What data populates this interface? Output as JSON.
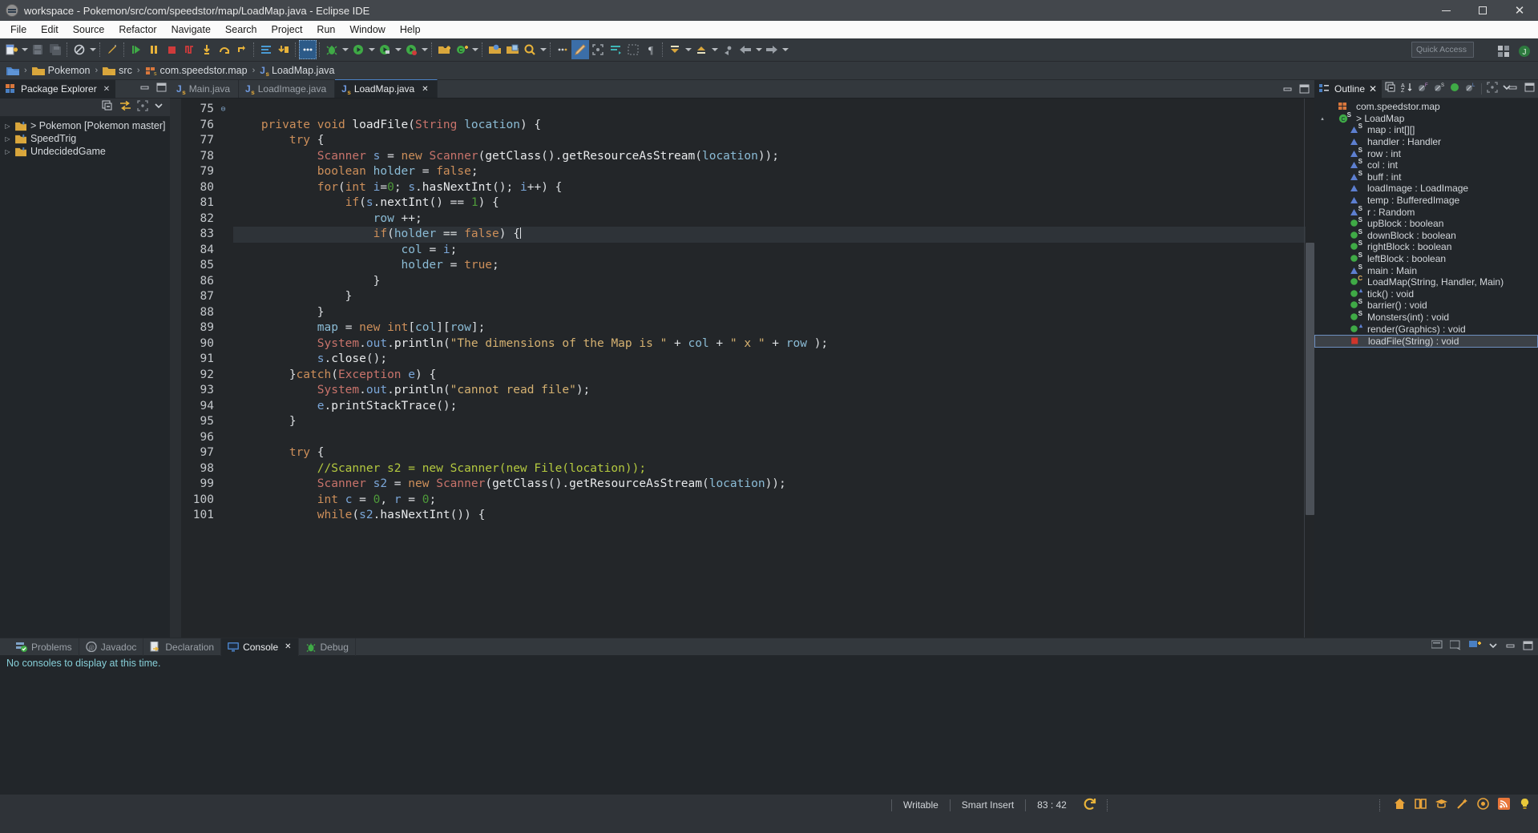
{
  "window": {
    "title": "workspace - Pokemon/src/com/speedstor/map/LoadMap.java - Eclipse IDE",
    "app_icon": "eclipse-icon",
    "minimize_label": "Minimize",
    "maximize_label": "Maximize",
    "close_label": "✕"
  },
  "menu": {
    "items": [
      "File",
      "Edit",
      "Source",
      "Refactor",
      "Navigate",
      "Search",
      "Project",
      "Run",
      "Window",
      "Help"
    ]
  },
  "toolbar": {
    "quick_access_placeholder": "Quick Access",
    "groups": [
      {
        "name": "file",
        "buttons": [
          {
            "icon": "new-wizard-icon",
            "label": "New",
            "dropdown": true,
            "color": "#e8b33a"
          },
          {
            "icon": "save-icon",
            "label": "Save",
            "dropdown": false,
            "color": "#5d646c"
          },
          {
            "icon": "save-all-icon",
            "label": "Save All",
            "dropdown": false,
            "color": "#5d646c"
          }
        ]
      },
      {
        "name": "skip-breakpoints",
        "buttons": [
          {
            "icon": "breakpoint-skip-icon",
            "label": "Skip All Breakpoints",
            "dropdown": true,
            "color": "#c9ced4"
          }
        ]
      },
      {
        "name": "debug-controls",
        "buttons": [
          {
            "icon": "resume-icon",
            "label": "Resume",
            "dropdown": false,
            "color": "#3faa46"
          },
          {
            "icon": "suspend-icon",
            "label": "Suspend",
            "dropdown": false,
            "color": "#e8b33a"
          },
          {
            "icon": "terminate-icon",
            "label": "Terminate",
            "dropdown": false,
            "color": "#cf3b3b"
          },
          {
            "icon": "disconnect-icon",
            "label": "Disconnect",
            "dropdown": false,
            "color": "#cf3b3b"
          },
          {
            "icon": "step-into-icon",
            "label": "Step Into",
            "dropdown": false,
            "color": "#e8b33a"
          },
          {
            "icon": "step-over-icon",
            "label": "Step Over",
            "dropdown": false,
            "color": "#e8b33a"
          },
          {
            "icon": "step-return-icon",
            "label": "Step Return",
            "dropdown": false,
            "color": "#e8b33a"
          }
        ]
      },
      {
        "name": "console",
        "buttons": [
          {
            "icon": "console-toggle-icon",
            "label": "Display Selected Console",
            "dropdown": false,
            "color": "#4a9bd4"
          },
          {
            "icon": "drop-to-frame-icon",
            "label": "Drop To Frame",
            "dropdown": false,
            "color": "#e8b33a"
          }
        ]
      },
      {
        "name": "inspect",
        "buttons": [
          {
            "icon": "more-icon",
            "label": "More",
            "dropdown": false,
            "color": "#c9ced4"
          }
        ]
      },
      {
        "name": "run-debug",
        "buttons": [
          {
            "icon": "debug-icon",
            "label": "Debug",
            "dropdown": true,
            "color": "#3faa46"
          },
          {
            "icon": "run-icon",
            "label": "Run",
            "dropdown": true,
            "color": "#3faa46"
          },
          {
            "icon": "coverage-icon",
            "label": "Coverage",
            "dropdown": true,
            "color": "#3faa46"
          },
          {
            "icon": "external-tools-icon",
            "label": "External Tools",
            "dropdown": true,
            "color": "#3faa46"
          }
        ]
      },
      {
        "name": "new-java",
        "buttons": [
          {
            "icon": "new-java-project-icon",
            "label": "New Java Project",
            "dropdown": false,
            "color": "#d9a63c"
          },
          {
            "icon": "new-class-icon",
            "label": "New Java Class",
            "dropdown": true,
            "color": "#3faa46"
          }
        ]
      },
      {
        "name": "open",
        "buttons": [
          {
            "icon": "open-type-icon",
            "label": "Open Type",
            "dropdown": false,
            "color": "#d9a63c"
          },
          {
            "icon": "open-task-icon",
            "label": "Open Task",
            "dropdown": false,
            "color": "#d9a63c"
          },
          {
            "icon": "search-icon",
            "label": "Search",
            "dropdown": true,
            "color": "#e8b33a"
          }
        ]
      },
      {
        "name": "editor-tools",
        "buttons": [
          {
            "icon": "last-edit-icon",
            "label": "Last Edit Location",
            "dropdown": false,
            "color": "#c9ced4"
          },
          {
            "icon": "pencil-icon",
            "label": "Toggle Mark Occurrences",
            "dropdown": false,
            "color": "#d9a63c"
          },
          {
            "icon": "focus-icon",
            "label": "Focus",
            "dropdown": false,
            "color": "#9aa0a7"
          },
          {
            "icon": "block-selection-icon",
            "label": "Toggle Block Selection",
            "dropdown": false,
            "color": "#3fb7b7"
          },
          {
            "icon": "show-whitespace-icon",
            "label": "Show Whitespace Characters",
            "dropdown": false,
            "color": "#9aa0a7"
          },
          {
            "icon": "pilcrow-icon",
            "label": "Paragraph Marks",
            "dropdown": false,
            "color": "#c9ced4"
          }
        ]
      },
      {
        "name": "annotations",
        "buttons": [
          {
            "icon": "next-annotation-icon",
            "label": "Next Annotation",
            "dropdown": true,
            "color": "#d9a63c"
          },
          {
            "icon": "previous-annotation-icon",
            "label": "Previous Annotation",
            "dropdown": true,
            "color": "#d9a63c"
          },
          {
            "icon": "back-to-file-icon",
            "label": "Back to File",
            "dropdown": false,
            "color": "#9aa0a7"
          },
          {
            "icon": "back-icon",
            "label": "Back",
            "dropdown": true,
            "color": "#9aa0a7"
          },
          {
            "icon": "forward-icon",
            "label": "Forward",
            "dropdown": true,
            "color": "#9aa0a7"
          }
        ]
      }
    ],
    "perspective_buttons": [
      {
        "icon": "open-perspective-icon",
        "label": "Open Perspective"
      },
      {
        "icon": "java-perspective-icon",
        "label": "Java"
      }
    ]
  },
  "breadcrumb": {
    "items": [
      {
        "icon": "project-root-icon",
        "label": ""
      },
      {
        "icon": "project-icon",
        "label": "Pokemon"
      },
      {
        "icon": "source-folder-icon",
        "label": "src"
      },
      {
        "icon": "package-icon",
        "label": "com.speedstor.map"
      },
      {
        "icon": "java-file-icon",
        "label": "LoadMap.java"
      }
    ],
    "separator": "›"
  },
  "package_explorer": {
    "tab_label": "Package Explorer",
    "tab_close": "✕",
    "toolbar": [
      {
        "icon": "collapse-all-icon",
        "label": "Collapse All"
      },
      {
        "icon": "link-with-editor-icon",
        "label": "Link with Editor"
      },
      {
        "icon": "focus-on-active-task-icon",
        "label": "Focus on Active Task"
      },
      {
        "icon": "view-menu-icon",
        "label": "View Menu"
      }
    ],
    "tree": [
      {
        "label": "> Pokemon [Pokemon master]",
        "icon": "java-project-icon",
        "expandable": true
      },
      {
        "label": "SpeedTrig",
        "icon": "java-project-icon",
        "expandable": true
      },
      {
        "label": "UndecidedGame",
        "icon": "java-project-icon",
        "expandable": true
      }
    ]
  },
  "editor": {
    "tabs": [
      {
        "label": "Main.java",
        "icon": "java-file-icon",
        "active": false,
        "closable": false
      },
      {
        "label": "LoadImage.java",
        "icon": "java-file-icon",
        "active": false,
        "closable": false
      },
      {
        "label": "LoadMap.java",
        "icon": "java-file-icon",
        "active": true,
        "closable": true,
        "close": "✕"
      }
    ],
    "controls": [
      {
        "icon": "restore-icon",
        "label": "Restore"
      },
      {
        "icon": "maximize-view-icon",
        "label": "Maximize"
      }
    ],
    "first_line_number": 75,
    "highlighted_line": 83,
    "lines": [
      {
        "n": 75,
        "fold": "",
        "text": ""
      },
      {
        "n": 76,
        "fold": "⊖",
        "text": "    private void loadFile(String location) {"
      },
      {
        "n": 77,
        "fold": "",
        "text": "        try {"
      },
      {
        "n": 78,
        "fold": "",
        "text": "            Scanner s = new Scanner(getClass().getResourceAsStream(location));"
      },
      {
        "n": 79,
        "fold": "",
        "text": "            boolean holder = false;"
      },
      {
        "n": 80,
        "fold": "",
        "text": "            for(int i=0; s.hasNextInt(); i++) {"
      },
      {
        "n": 81,
        "fold": "",
        "text": "                if(s.nextInt() == 1) {"
      },
      {
        "n": 82,
        "fold": "",
        "text": "                    row ++;"
      },
      {
        "n": 83,
        "fold": "",
        "text": "                    if(holder == false) {"
      },
      {
        "n": 84,
        "fold": "",
        "text": "                        col = i;"
      },
      {
        "n": 85,
        "fold": "",
        "text": "                        holder = true;"
      },
      {
        "n": 86,
        "fold": "",
        "text": "                    }"
      },
      {
        "n": 87,
        "fold": "",
        "text": "                }"
      },
      {
        "n": 88,
        "fold": "",
        "text": "            }"
      },
      {
        "n": 89,
        "fold": "",
        "text": "            map = new int[col][row];"
      },
      {
        "n": 90,
        "fold": "",
        "text": "            System.out.println(\"The dimensions of the Map is \" + col + \" x \" + row );"
      },
      {
        "n": 91,
        "fold": "",
        "text": "            s.close();"
      },
      {
        "n": 92,
        "fold": "",
        "text": "        }catch(Exception e) {"
      },
      {
        "n": 93,
        "fold": "",
        "text": "            System.out.println(\"cannot read file\");"
      },
      {
        "n": 94,
        "fold": "",
        "text": "            e.printStackTrace();"
      },
      {
        "n": 95,
        "fold": "",
        "text": "        }"
      },
      {
        "n": 96,
        "fold": "",
        "text": ""
      },
      {
        "n": 97,
        "fold": "",
        "text": "        try {"
      },
      {
        "n": 98,
        "fold": "",
        "text": "            //Scanner s2 = new Scanner(new File(location));"
      },
      {
        "n": 99,
        "fold": "",
        "text": "            Scanner s2 = new Scanner(getClass().getResourceAsStream(location));"
      },
      {
        "n": 100,
        "fold": "",
        "text": "            int c = 0, r = 0;"
      },
      {
        "n": 101,
        "fold": "",
        "text": "            while(s2.hasNextInt()) {"
      }
    ]
  },
  "outline": {
    "tab_label": "Outline",
    "tab_close": "✕",
    "toolbar": [
      {
        "icon": "collapse-all-icon",
        "label": "Collapse All"
      },
      {
        "icon": "sort-icon",
        "label": "Sort"
      },
      {
        "icon": "hide-fields-icon",
        "label": "Hide Fields"
      },
      {
        "icon": "hide-static-icon",
        "label": "Hide Static Fields and Methods"
      },
      {
        "icon": "hide-non-public-icon",
        "label": "Hide Non-Public Members"
      },
      {
        "icon": "hide-local-types-icon",
        "label": "Hide Local Types"
      },
      {
        "icon": "focus-on-active-task-icon",
        "label": "Focus on Active Task"
      },
      {
        "icon": "view-menu-icon",
        "label": "View Menu"
      },
      {
        "icon": "minimize-icon",
        "label": "Minimize"
      },
      {
        "icon": "maximize-icon",
        "label": "Maximize"
      }
    ],
    "items": [
      {
        "label": "com.speedstor.map",
        "icon": "package-icon",
        "indent": 1,
        "marker": "",
        "sup": "",
        "twisty": ""
      },
      {
        "label": "> LoadMap",
        "icon": "class-icon",
        "indent": 1,
        "marker": "class",
        "sup": "S",
        "twisty": "▴"
      },
      {
        "label": "map : int[][]",
        "icon": "field-private-icon",
        "indent": 2,
        "marker": "tri",
        "sup": "S",
        "twisty": ""
      },
      {
        "label": "handler : Handler",
        "icon": "field-private-icon",
        "indent": 2,
        "marker": "tri",
        "sup": "",
        "twisty": ""
      },
      {
        "label": "row : int",
        "icon": "field-private-icon",
        "indent": 2,
        "marker": "tri",
        "sup": "S",
        "twisty": ""
      },
      {
        "label": "col : int",
        "icon": "field-private-icon",
        "indent": 2,
        "marker": "tri",
        "sup": "S",
        "twisty": ""
      },
      {
        "label": "buff : int",
        "icon": "field-private-icon",
        "indent": 2,
        "marker": "tri",
        "sup": "S",
        "twisty": ""
      },
      {
        "label": "loadImage : LoadImage",
        "icon": "field-private-icon",
        "indent": 2,
        "marker": "tri",
        "sup": "",
        "twisty": ""
      },
      {
        "label": "temp : BufferedImage",
        "icon": "field-private-icon",
        "indent": 2,
        "marker": "tri",
        "sup": "",
        "twisty": ""
      },
      {
        "label": "r : Random",
        "icon": "field-private-icon",
        "indent": 2,
        "marker": "tri",
        "sup": "S",
        "twisty": ""
      },
      {
        "label": "upBlock : boolean",
        "icon": "field-public-icon",
        "indent": 2,
        "marker": "dot",
        "sup": "S",
        "twisty": ""
      },
      {
        "label": "downBlock : boolean",
        "icon": "field-public-icon",
        "indent": 2,
        "marker": "dot",
        "sup": "S",
        "twisty": ""
      },
      {
        "label": "rightBlock : boolean",
        "icon": "field-public-icon",
        "indent": 2,
        "marker": "dot",
        "sup": "S",
        "twisty": ""
      },
      {
        "label": "leftBlock : boolean",
        "icon": "field-public-icon",
        "indent": 2,
        "marker": "dot",
        "sup": "S",
        "twisty": ""
      },
      {
        "label": "main : Main",
        "icon": "field-private-icon",
        "indent": 2,
        "marker": "tri",
        "sup": "S",
        "twisty": ""
      },
      {
        "label": "LoadMap(String, Handler, Main)",
        "icon": "constructor-icon",
        "indent": 2,
        "marker": "dot",
        "sup": "C",
        "twisty": ""
      },
      {
        "label": "tick() : void",
        "icon": "method-public-icon",
        "indent": 2,
        "marker": "dot",
        "sup": "t",
        "twisty": ""
      },
      {
        "label": "barrier() : void",
        "icon": "method-public-icon",
        "indent": 2,
        "marker": "dot",
        "sup": "S",
        "twisty": ""
      },
      {
        "label": "Monsters(int) : void",
        "icon": "method-public-icon",
        "indent": 2,
        "marker": "dot",
        "sup": "S",
        "twisty": ""
      },
      {
        "label": "render(Graphics) : void",
        "icon": "method-public-icon",
        "indent": 2,
        "marker": "dot",
        "sup": "t",
        "twisty": ""
      },
      {
        "label": "loadFile(String) : void",
        "icon": "method-private-icon",
        "indent": 2,
        "marker": "sq",
        "sup": "",
        "twisty": "",
        "selected": true
      }
    ]
  },
  "bottom_panel": {
    "tabs": [
      {
        "label": "Problems",
        "icon": "problems-icon",
        "active": false
      },
      {
        "label": "Javadoc",
        "icon": "javadoc-icon",
        "active": false
      },
      {
        "label": "Declaration",
        "icon": "declaration-icon",
        "active": false
      },
      {
        "label": "Console",
        "icon": "console-icon",
        "active": true,
        "close": "✕"
      },
      {
        "label": "Debug",
        "icon": "debug-icon",
        "active": false
      }
    ],
    "controls": [
      {
        "icon": "display-selected-console-icon",
        "label": "Display Selected Console"
      },
      {
        "icon": "open-console-icon",
        "label": "Open Console"
      },
      {
        "icon": "new-console-view-icon",
        "label": "New Console View"
      },
      {
        "icon": "view-menu-icon",
        "label": "View Menu"
      },
      {
        "icon": "minimize-icon",
        "label": "Minimize"
      },
      {
        "icon": "maximize-icon",
        "label": "Maximize"
      }
    ],
    "console_message": "No consoles to display at this time."
  },
  "status_bar": {
    "writable": "Writable",
    "insert_mode": "Smart Insert",
    "cursor_position": "83 : 42",
    "sync_icon": "refresh-icon",
    "tray_icons": [
      {
        "icon": "home-icon",
        "label": "Home",
        "color": "#e8a33a"
      },
      {
        "icon": "book-icon",
        "label": "Tutorials",
        "color": "#e8a33a"
      },
      {
        "icon": "graduation-icon",
        "label": "Samples",
        "color": "#e8a33a"
      },
      {
        "icon": "wand-icon",
        "label": "What's New",
        "color": "#e8a33a"
      },
      {
        "icon": "badge-icon",
        "label": "Badge",
        "color": "#e8a33a"
      },
      {
        "icon": "rss-icon",
        "label": "News",
        "color": "#e8763a"
      },
      {
        "icon": "tip-icon",
        "label": "Tip of the Day",
        "color": "#e8c83a"
      }
    ]
  },
  "colors": {
    "accent": "#4b81c4",
    "editor_bg": "#232629",
    "panel_bg": "#22262a",
    "chrome_bg": "#33383d",
    "title_bg": "#43474c",
    "keyword": "#cd8f5a",
    "string": "#d5b171",
    "comment": "#b4c93f",
    "type": "#c8736b",
    "number": "#4e9a3a",
    "field": "#8bbcd6"
  }
}
